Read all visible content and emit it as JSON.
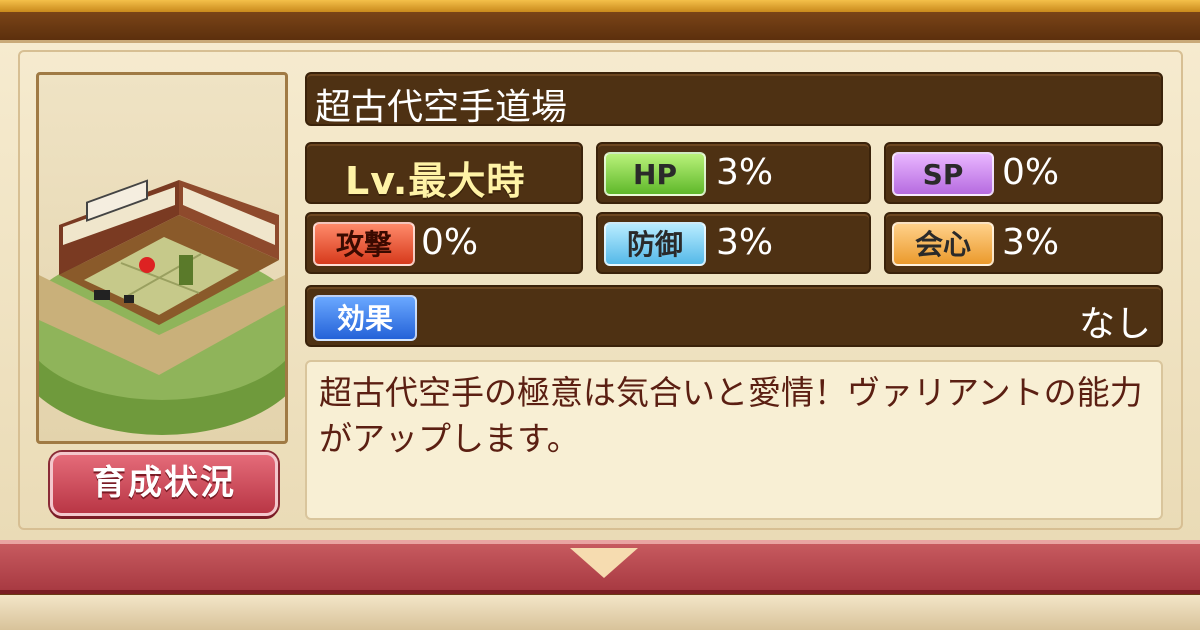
{
  "facility": {
    "name": "超古代空手道場",
    "level_label": "Lv.最大時"
  },
  "stats": {
    "hp": {
      "label": "HP",
      "value": "3%"
    },
    "sp": {
      "label": "SP",
      "value": "0%"
    },
    "attack": {
      "label": "攻撃",
      "value": "0%"
    },
    "defense": {
      "label": "防御",
      "value": "3%"
    },
    "critical": {
      "label": "会心",
      "value": "3%"
    }
  },
  "effect": {
    "label": "効果",
    "value": "なし"
  },
  "description": "超古代空手の極意は気合いと愛情！ヴァリアントの能力がアップします。",
  "buttons": {
    "training_status": "育成状況"
  },
  "icons": {
    "expand": "chevron-down-icon",
    "thumbnail": "dojo-room-image"
  },
  "colors": {
    "hp": "#6fc63a",
    "sp": "#c07ae6",
    "attack": "#e0492a",
    "defense": "#6cc4ee",
    "critical": "#f0a33a",
    "effect": "#3b78e6",
    "panel_dark": "#4e3113"
  }
}
